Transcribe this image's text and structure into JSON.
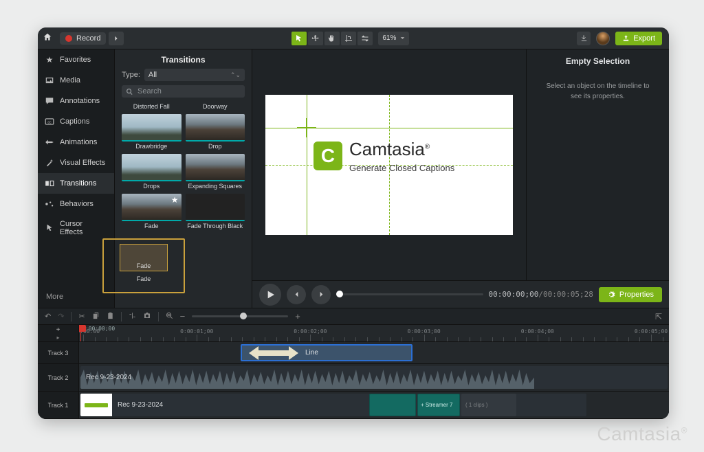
{
  "topbar": {
    "record_label": "Record",
    "zoom": "61%",
    "export_label": "Export"
  },
  "sidebar": {
    "items": [
      {
        "label": "Favorites",
        "icon": "star"
      },
      {
        "label": "Media",
        "icon": "media"
      },
      {
        "label": "Annotations",
        "icon": "annot"
      },
      {
        "label": "Captions",
        "icon": "cc"
      },
      {
        "label": "Animations",
        "icon": "anim"
      },
      {
        "label": "Visual Effects",
        "icon": "wand"
      },
      {
        "label": "Transitions",
        "icon": "trans",
        "active": true
      },
      {
        "label": "Behaviors",
        "icon": "behav"
      },
      {
        "label": "Cursor Effects",
        "icon": "cursor"
      }
    ],
    "more": "More"
  },
  "panel": {
    "title": "Transitions",
    "type_label": "Type:",
    "type_value": "All",
    "search_placeholder": "Search",
    "items": [
      {
        "label": "Distorted Fall"
      },
      {
        "label": "Doorway"
      },
      {
        "label": "Drawbridge"
      },
      {
        "label": "Drop"
      },
      {
        "label": "Drops"
      },
      {
        "label": "Expanding Squares"
      },
      {
        "label": "Fade",
        "fav": true
      },
      {
        "label": "Fade Through Black"
      }
    ],
    "drag_label": "Fade",
    "drag_sublabel": "Fade"
  },
  "preview": {
    "brand": "Camtasia",
    "subtitle": "Generate Closed Captions"
  },
  "properties": {
    "title": "Empty Selection",
    "message": "Select an object on the timeline to see its properties.",
    "button": "Properties"
  },
  "playbar": {
    "current": "00:00:00;00",
    "total": "00:00:05;28"
  },
  "timeline": {
    "start_tc": "0:00:00;00",
    "ticks": [
      "0:00:00:00",
      "0:00:01;00",
      "0:00:02;00",
      "0:00:03;00",
      "0:00:04;00",
      "0:00:05;00"
    ],
    "tracks": [
      {
        "name": "Track 3"
      },
      {
        "name": "Track 2"
      },
      {
        "name": "Track 1"
      }
    ],
    "clip_line_label": "Line",
    "clip_rec_a": "Rec 9-23-2024",
    "clip_rec_b": "Rec 9-23-2024",
    "clip_streamer": "+ Streamer 7",
    "clip_tail": "( 1 clips )"
  },
  "watermark": "Camtasia"
}
